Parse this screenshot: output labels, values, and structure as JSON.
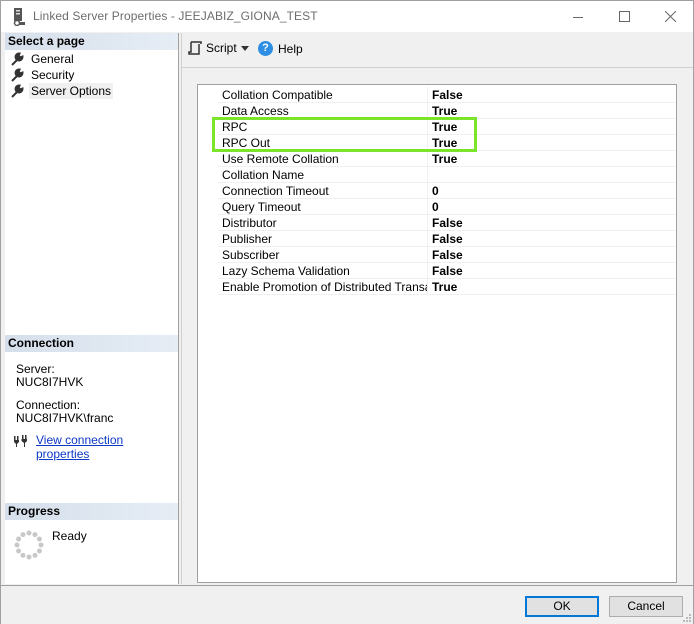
{
  "window": {
    "title": "Linked Server Properties - JEEJABIZ_GIONA_TEST",
    "title_icon": "server-properties-icon",
    "controls": {
      "minimize": "minimize-icon",
      "maximize": "maximize-icon",
      "close": "close-icon"
    }
  },
  "left_pane": {
    "select_page": {
      "header": "Select a page",
      "items": [
        {
          "label": "General",
          "icon": "wrench-icon",
          "selected": false
        },
        {
          "label": "Security",
          "icon": "wrench-icon",
          "selected": false
        },
        {
          "label": "Server Options",
          "icon": "wrench-icon",
          "selected": true
        }
      ]
    },
    "connection": {
      "header": "Connection",
      "server_label": "Server:",
      "server_value": "NUC8I7HVK",
      "connection_label": "Connection:",
      "connection_value": "NUC8I7HVK\\franc",
      "link_label": "View connection properties",
      "link_icon": "plug-icon"
    },
    "progress": {
      "header": "Progress",
      "status": "Ready",
      "icon": "spinner-icon"
    }
  },
  "toolbar": {
    "script_label": "Script",
    "help_label": "Help",
    "help_glyph": "?"
  },
  "properties": [
    {
      "name": "Collation Compatible",
      "value": "False"
    },
    {
      "name": "Data Access",
      "value": "True"
    },
    {
      "name": "RPC",
      "value": "True",
      "highlighted": true
    },
    {
      "name": "RPC Out",
      "value": "True",
      "highlighted": true
    },
    {
      "name": "Use Remote Collation",
      "value": "True"
    },
    {
      "name": "Collation Name",
      "value": ""
    },
    {
      "name": "Connection Timeout",
      "value": "0"
    },
    {
      "name": "Query Timeout",
      "value": "0"
    },
    {
      "name": "Distributor",
      "value": "False"
    },
    {
      "name": "Publisher",
      "value": "False"
    },
    {
      "name": "Subscriber",
      "value": "False"
    },
    {
      "name": "Lazy Schema Validation",
      "value": "False"
    },
    {
      "name": "Enable Promotion of Distributed Transaction",
      "value": "True"
    }
  ],
  "highlight_color": "#7be52c",
  "buttons": {
    "ok": "OK",
    "cancel": "Cancel"
  }
}
